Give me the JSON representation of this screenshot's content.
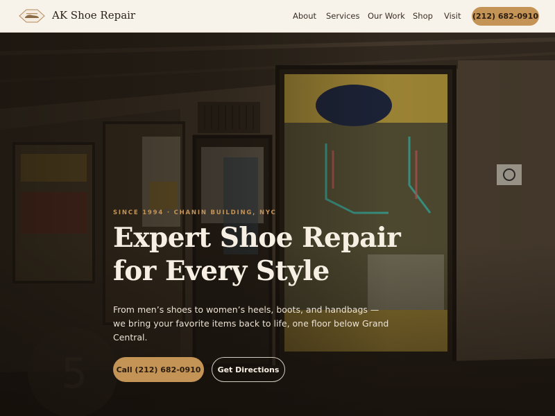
{
  "brand": {
    "name": "AK Shoe Repair",
    "logo_icon": "shoe-logo-icon"
  },
  "nav": {
    "items": [
      "About",
      "Services",
      "Our Work",
      "Shop",
      "Visit"
    ],
    "phone": "(212) 682-0910"
  },
  "hero": {
    "eyebrow": "SINCE 1994 · CHANIN BUILDING, NYC",
    "headline": "Expert Shoe Repair for Every Style",
    "subtext": "From men’s shoes to women’s heels, boots, and handbags — we bring your favorite items back to life, one floor below Grand Central.",
    "call_button": "Call (212) 682-0910",
    "directions_button": "Get Directions"
  },
  "colors": {
    "accent": "#c49356",
    "header_bg": "#f7f2ea",
    "headline": "#f7efe3"
  }
}
